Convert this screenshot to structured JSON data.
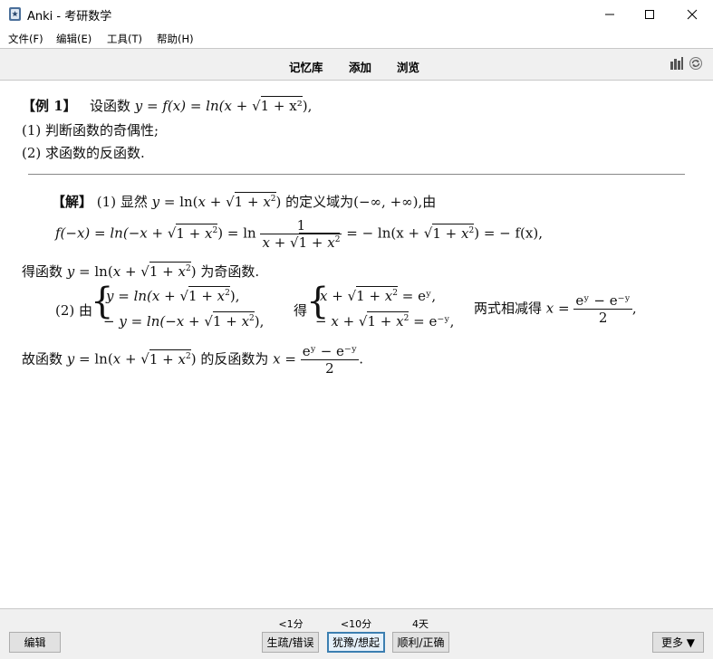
{
  "window": {
    "title": "Anki - 考研数学"
  },
  "menu": {
    "file": "文件(F)",
    "edit": "编辑(E)",
    "tools": "工具(T)",
    "help": "帮助(H)"
  },
  "toolbar": {
    "decks": "记忆库",
    "add": "添加",
    "browse": "浏览"
  },
  "card": {
    "q_label": "【例 1】",
    "q_prefix": "设函数",
    "q_formula_lhs": "y = f(x) = ln(x +",
    "q_sqrt": "1 + x²",
    "q_end": "),",
    "q1": "(1) 判断函数的奇偶性;",
    "q2": "(2) 求函数的反函数.",
    "a_label": "【解】",
    "a1_start": "(1) 显然",
    "a1_tail": "的定义域为(−∞, +∞),由",
    "a2_f": "f(−x) = ln(−x +",
    "a2_mid": ") = ln",
    "frac1_num": "1",
    "a2_eq": "= − ln(x +",
    "a2_end": ") = − f(x),",
    "a3_start": "得函数",
    "a3_tail": "为奇函数.",
    "a4_start": "(2) 由",
    "sys1_a": "y = ln(x +",
    "sys1_b": "− y = ln(−x +",
    "a4_mid": "得",
    "sys2_a_end": "= eʸ,",
    "sys2_b_end": "= e⁻ʸ,",
    "a4_tail": "两式相减得",
    "frac2_num": "eʸ − e⁻ʸ",
    "frac2_den": "2",
    "a5_start": "故函数",
    "a5_tail": "的反函数为"
  },
  "answer_buttons": [
    {
      "interval": "<1分",
      "label": "生疏/错误"
    },
    {
      "interval": "<10分",
      "label": "犹豫/想起"
    },
    {
      "interval": "4天",
      "label": "顺利/正确"
    }
  ],
  "bottom": {
    "edit": "编辑",
    "more": "更多 ▼"
  }
}
